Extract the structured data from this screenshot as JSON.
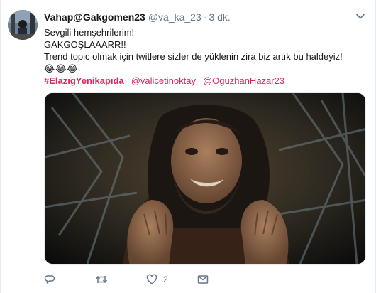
{
  "tweet": {
    "display_name": "Vahap@Gakgomen23",
    "handle": "@va_ka_23",
    "separator": "·",
    "time": "3 dk.",
    "lines": [
      "Sevgili hemşehrilerim!",
      "GAKGOŞLAAARR!!",
      "Trend topic olmak için twitlere sizler de yüklenin zira biz artık bu haldeyiz!"
    ],
    "emojis": "😂😂😂",
    "hashtag": "#ElazığYenikapıda",
    "mentions": [
      "@valicetinoktay",
      "@OguzhanHazar23"
    ]
  },
  "actions": {
    "reply_icon": "reply-icon",
    "retweet_icon": "retweet-icon",
    "like_icon": "heart-icon",
    "like_count": "2",
    "dm_icon": "envelope-icon"
  },
  "colors": {
    "accent": "#e0245e",
    "muted": "#657786",
    "text": "#14171a"
  }
}
